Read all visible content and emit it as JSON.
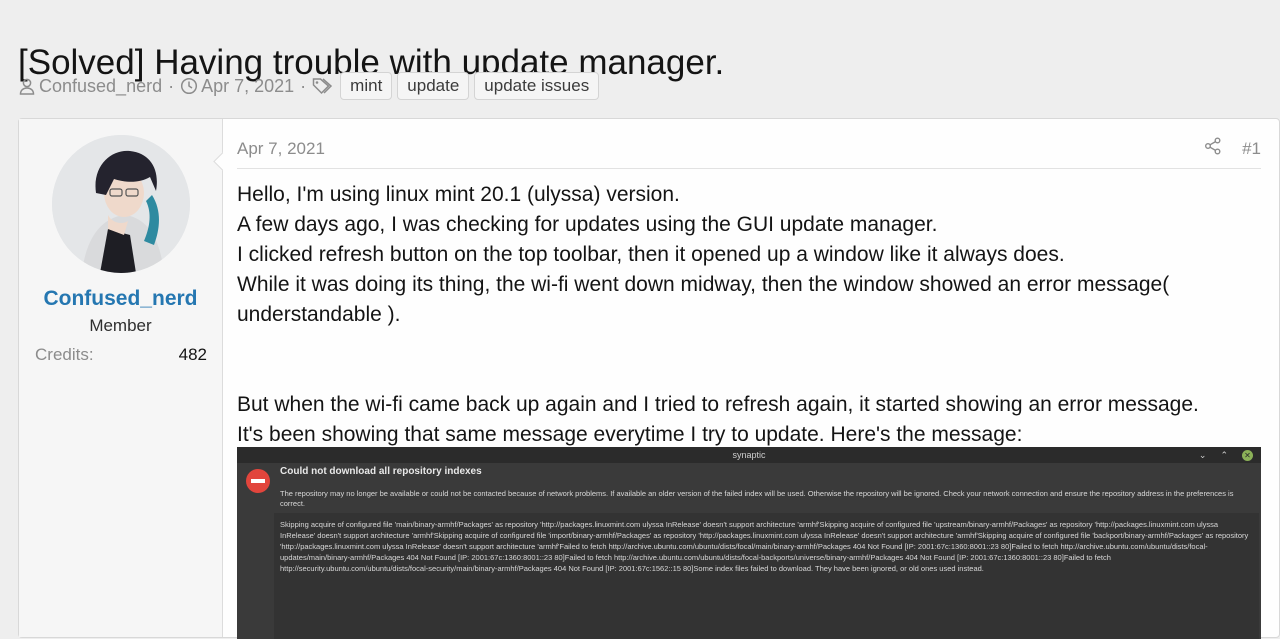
{
  "thread": {
    "title": "[Solved] Having trouble with update manager.",
    "author": "Confused_nerd",
    "date": "Apr 7, 2021",
    "tags": [
      "mint",
      "update",
      "update issues"
    ]
  },
  "post": {
    "user": {
      "name": "Confused_nerd",
      "title": "Member",
      "credits_label": "Credits:",
      "credits_value": "482"
    },
    "date": "Apr 7, 2021",
    "number": "#1",
    "paragraphs": [
      "Hello, I'm using linux mint 20.1 (ulyssa) version.",
      "A few days ago, I was checking for updates using the GUI update manager.",
      "I clicked refresh button on the top toolbar, then it opened up a window like it always does.",
      "While it was doing its thing, the wi-fi went down midway, then the window showed an error message( understandable ).",
      "But when the wi-fi came back up again and I tried to refresh again, it started showing an error message.",
      "It's been showing that same message everytime I try to update. Here's the message:"
    ]
  },
  "screenshot": {
    "window_title": "synaptic",
    "heading": "Could not download all repository indexes",
    "description": "The repository may no longer be available or could not be contacted because of network problems. If available an older version of the failed index will be used. Otherwise the repository will be ignored. Check your network connection and ensure the repository address in the preferences is correct.",
    "details": "Skipping acquire of configured file 'main/binary-armhf/Packages' as repository 'http://packages.linuxmint.com ulyssa InRelease' doesn't support architecture 'armhf'Skipping acquire of configured file 'upstream/binary-armhf/Packages' as repository 'http://packages.linuxmint.com ulyssa InRelease' doesn't support architecture 'armhf'Skipping acquire of configured file 'import/binary-armhf/Packages' as repository 'http://packages.linuxmint.com ulyssa InRelease' doesn't support architecture 'armhf'Skipping acquire of configured file 'backport/binary-armhf/Packages' as repository 'http://packages.linuxmint.com ulyssa InRelease' doesn't support architecture 'armhf'Failed to fetch http://archive.ubuntu.com/ubuntu/dists/focal/main/binary-armhf/Packages  404  Not Found [IP: 2001:67c:1360:8001::23 80]Failed to fetch http://archive.ubuntu.com/ubuntu/dists/focal-updates/main/binary-armhf/Packages  404  Not Found [IP: 2001:67c:1360:8001::23 80]Failed to fetch http://archive.ubuntu.com/ubuntu/dists/focal-backports/universe/binary-armhf/Packages  404  Not Found [IP: 2001:67c:1360:8001::23 80]Failed to fetch http://security.ubuntu.com/ubuntu/dists/focal-security/main/binary-armhf/Packages  404  Not Found [IP: 2001:67c:1562::15 80]Some index files failed to download. They have been ignored, or old ones used instead."
  },
  "icons": [
    "user-icon",
    "clock-icon",
    "tag-icon",
    "share-icon",
    "error-icon"
  ],
  "colors": {
    "username": "#2577b1",
    "page_bg": "#eeeeee",
    "meta_text": "#8c8c8c"
  }
}
